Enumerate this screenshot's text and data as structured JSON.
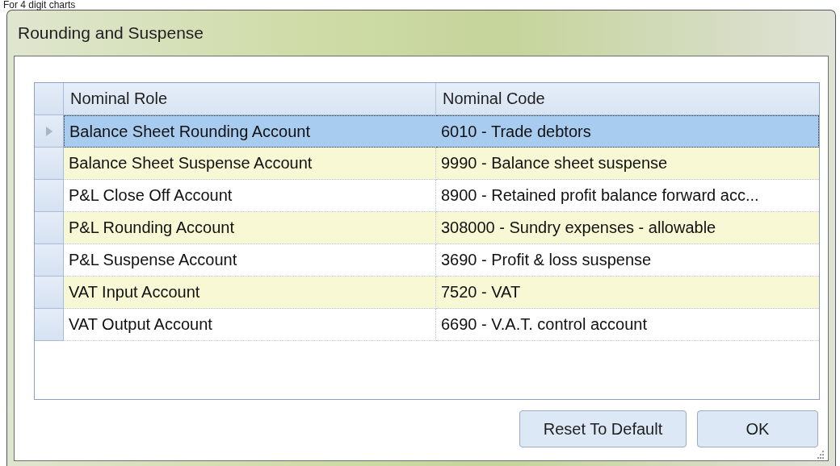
{
  "caption": "For 4 digit charts",
  "window": {
    "title": "Rounding and Suspense"
  },
  "table": {
    "columns": [
      "Nominal Role",
      "Nominal Code"
    ],
    "rows": [
      {
        "role": "Balance Sheet Rounding Account",
        "code": "6010 - Trade debtors",
        "selected": true
      },
      {
        "role": "Balance Sheet Suspense Account",
        "code": "9990 - Balance sheet suspense",
        "selected": false
      },
      {
        "role": "P&L Close Off Account",
        "code": "8900 - Retained profit balance forward acc...",
        "selected": false
      },
      {
        "role": "P&L Rounding Account",
        "code": "308000 - Sundry expenses - allowable",
        "selected": false
      },
      {
        "role": "P&L Suspense Account",
        "code": "3690 - Profit & loss suspense",
        "selected": false
      },
      {
        "role": "VAT Input Account",
        "code": "7520 - VAT",
        "selected": false
      },
      {
        "role": "VAT Output Account",
        "code": "6690 - V.A.T. control account",
        "selected": false
      }
    ]
  },
  "buttons": [
    "Reset To Default",
    "OK"
  ]
}
